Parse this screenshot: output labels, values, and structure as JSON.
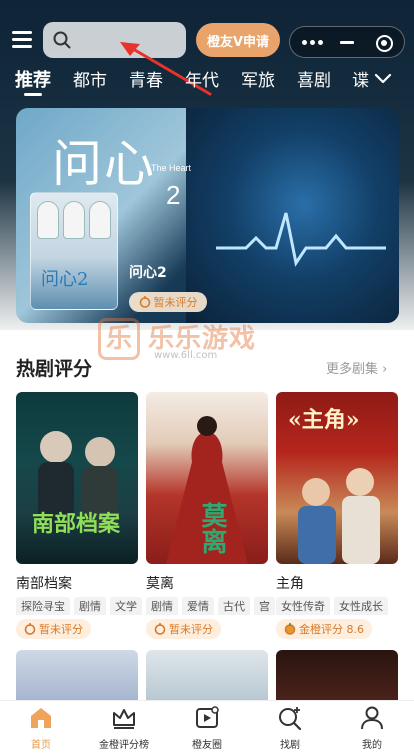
{
  "header": {
    "vip_button": "橙友V申请",
    "search_placeholder": ""
  },
  "tabs": [
    "推荐",
    "都市",
    "青春",
    "年代",
    "军旅",
    "喜剧",
    "谍"
  ],
  "banner": {
    "title_art": "问心",
    "title_num": "2",
    "title_en": "The Heart",
    "mini_poster_title": "问心2",
    "show_name": "问心2",
    "score": "暂未评分"
  },
  "watermark": {
    "brand": "乐乐游戏",
    "logo_char": "乐",
    "url": "www.6ll.com"
  },
  "section": {
    "title": "热剧评分",
    "more": "更多剧集 ›"
  },
  "dramas": [
    {
      "name": "南部档案",
      "tags": [
        "探险寻宝",
        "剧情",
        "文学"
      ],
      "score": "暂未评分",
      "poster_title": "南部档案"
    },
    {
      "name": "莫离",
      "tags": [
        "剧情",
        "爱情",
        "古代",
        "宫"
      ],
      "score": "暂未评分",
      "poster_title": "莫离"
    },
    {
      "name": "主角",
      "tags": [
        "女性传奇",
        "女性成长"
      ],
      "score": "金橙评分 8.6",
      "poster_title": "«主角»"
    }
  ],
  "bottom_nav": [
    {
      "label": "首页",
      "icon": "home-icon",
      "active": true
    },
    {
      "label": "金橙评分榜",
      "icon": "crown-icon",
      "active": false
    },
    {
      "label": "橙友圈",
      "icon": "play-icon",
      "active": false
    },
    {
      "label": "找剧",
      "icon": "search-plus-icon",
      "active": false
    },
    {
      "label": "我的",
      "icon": "user-icon",
      "active": false
    }
  ],
  "colors": {
    "accent": "#e8a46a",
    "score_text": "#d97a2a",
    "active_nav": "#e59a4e"
  }
}
